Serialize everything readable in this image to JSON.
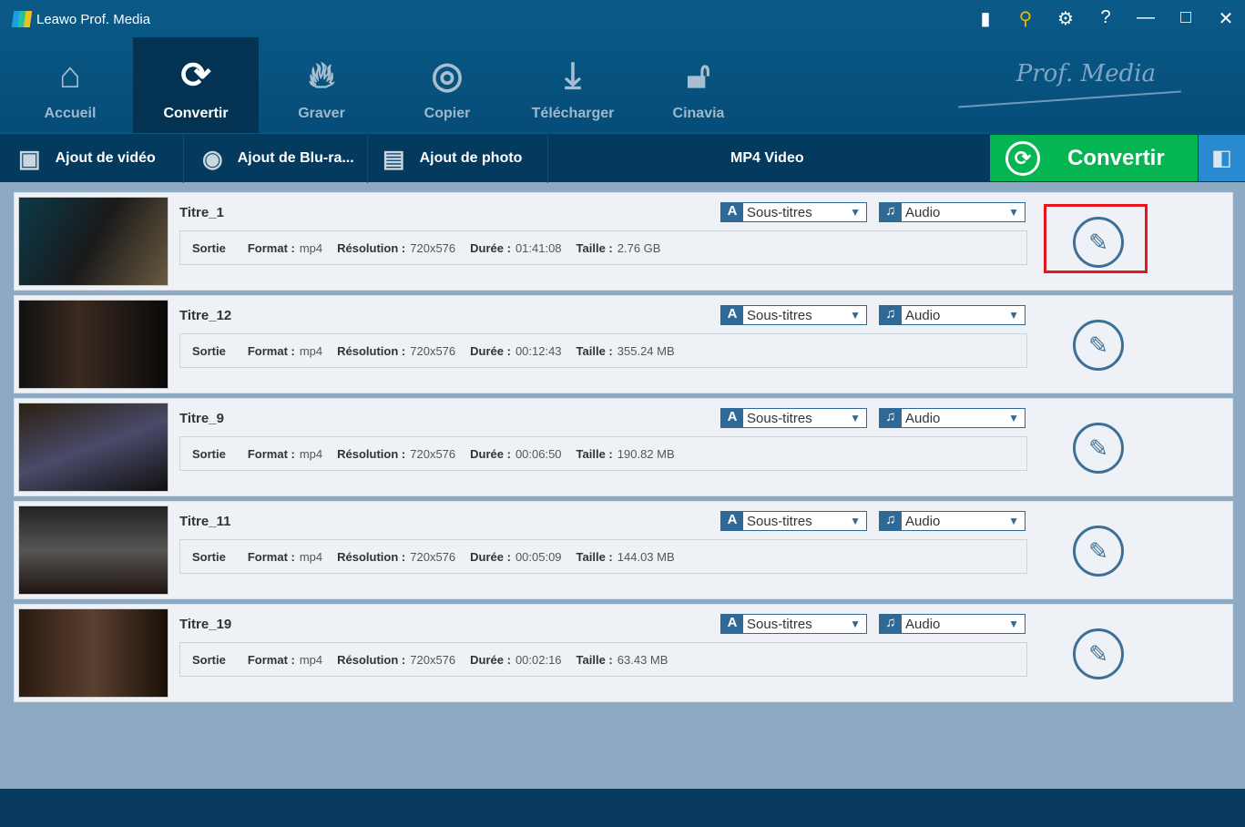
{
  "app": {
    "title": "Leawo Prof. Media",
    "brand": "Prof. Media"
  },
  "nav": [
    {
      "label": "Accueil",
      "icon": "home-icon"
    },
    {
      "label": "Convertir",
      "icon": "convert-icon",
      "active": true
    },
    {
      "label": "Graver",
      "icon": "flame-icon"
    },
    {
      "label": "Copier",
      "icon": "disc-icon"
    },
    {
      "label": "Télécharger",
      "icon": "download-icon"
    },
    {
      "label": "Cinavia",
      "icon": "unlock-icon"
    }
  ],
  "toolbar": {
    "add_video": "Ajout de vidéo",
    "add_bluray": "Ajout de Blu-ra...",
    "add_photo": "Ajout de photo",
    "format": "MP4 Video",
    "convert": "Convertir"
  },
  "labels": {
    "output": "Sortie",
    "format": "Format :",
    "resolution": "Résolution :",
    "duration": "Durée :",
    "size": "Taille :",
    "subtitles": "Sous-titres",
    "audio": "Audio"
  },
  "rows": [
    {
      "title": "Titre_1",
      "format": "mp4",
      "resolution": "720x576",
      "duration": "01:41:08",
      "size": "2.76 GB"
    },
    {
      "title": "Titre_12",
      "format": "mp4",
      "resolution": "720x576",
      "duration": "00:12:43",
      "size": "355.24 MB"
    },
    {
      "title": "Titre_9",
      "format": "mp4",
      "resolution": "720x576",
      "duration": "00:06:50",
      "size": "190.82 MB"
    },
    {
      "title": "Titre_11",
      "format": "mp4",
      "resolution": "720x576",
      "duration": "00:05:09",
      "size": "144.03 MB"
    },
    {
      "title": "Titre_19",
      "format": "mp4",
      "resolution": "720x576",
      "duration": "00:02:16",
      "size": "63.43 MB"
    }
  ],
  "colors": {
    "convert_green": "#05b552",
    "highlight_red": "#e8141e"
  }
}
